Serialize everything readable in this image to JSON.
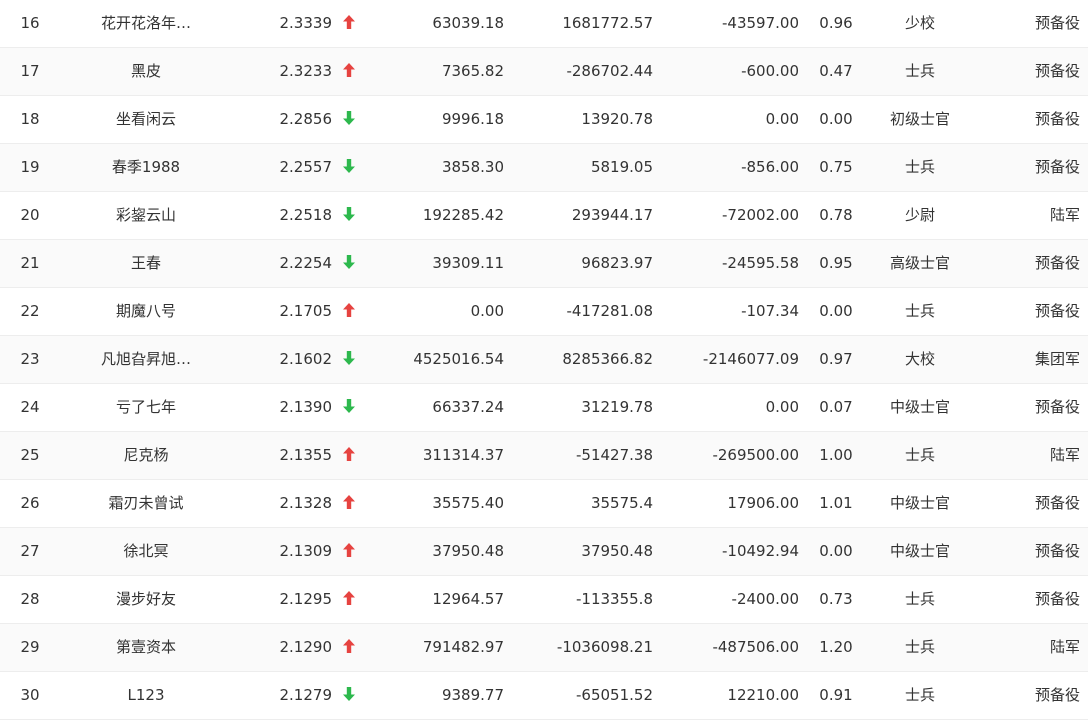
{
  "colors": {
    "up": "#e64340",
    "down": "#2db84d"
  },
  "rows": [
    {
      "rank": "16",
      "name": "花开花洛年…",
      "score": "2.3339",
      "trend": "up",
      "v1": "63039.18",
      "v2": "1681772.57",
      "v3": "-43597.00",
      "ratio": "0.96",
      "title": "少校",
      "army": "预备役"
    },
    {
      "rank": "17",
      "name": "黑皮",
      "score": "2.3233",
      "trend": "up",
      "v1": "7365.82",
      "v2": "-286702.44",
      "v3": "-600.00",
      "ratio": "0.47",
      "title": "士兵",
      "army": "预备役"
    },
    {
      "rank": "18",
      "name": "坐看闲云",
      "score": "2.2856",
      "trend": "down",
      "v1": "9996.18",
      "v2": "13920.78",
      "v3": "0.00",
      "ratio": "0.00",
      "title": "初级士官",
      "army": "预备役"
    },
    {
      "rank": "19",
      "name": "春季1988",
      "score": "2.2557",
      "trend": "down",
      "v1": "3858.30",
      "v2": "5819.05",
      "v3": "-856.00",
      "ratio": "0.75",
      "title": "士兵",
      "army": "预备役"
    },
    {
      "rank": "20",
      "name": "彩鋆云山",
      "score": "2.2518",
      "trend": "down",
      "v1": "192285.42",
      "v2": "293944.17",
      "v3": "-72002.00",
      "ratio": "0.78",
      "title": "少尉",
      "army": "陆军"
    },
    {
      "rank": "21",
      "name": "王春",
      "score": "2.2254",
      "trend": "down",
      "v1": "39309.11",
      "v2": "96823.97",
      "v3": "-24595.58",
      "ratio": "0.95",
      "title": "高级士官",
      "army": "预备役"
    },
    {
      "rank": "22",
      "name": "期魔八号",
      "score": "2.1705",
      "trend": "up",
      "v1": "0.00",
      "v2": "-417281.08",
      "v3": "-107.34",
      "ratio": "0.00",
      "title": "士兵",
      "army": "预备役"
    },
    {
      "rank": "23",
      "name": "凡旭旮昇旭…",
      "score": "2.1602",
      "trend": "down",
      "v1": "4525016.54",
      "v2": "8285366.82",
      "v3": "-2146077.09",
      "ratio": "0.97",
      "title": "大校",
      "army": "集团军"
    },
    {
      "rank": "24",
      "name": "亏了七年",
      "score": "2.1390",
      "trend": "down",
      "v1": "66337.24",
      "v2": "31219.78",
      "v3": "0.00",
      "ratio": "0.07",
      "title": "中级士官",
      "army": "预备役"
    },
    {
      "rank": "25",
      "name": "尼克杨",
      "score": "2.1355",
      "trend": "up",
      "v1": "311314.37",
      "v2": "-51427.38",
      "v3": "-269500.00",
      "ratio": "1.00",
      "title": "士兵",
      "army": "陆军"
    },
    {
      "rank": "26",
      "name": "霜刃未曾试",
      "score": "2.1328",
      "trend": "up",
      "v1": "35575.40",
      "v2": "35575.4",
      "v3": "17906.00",
      "ratio": "1.01",
      "title": "中级士官",
      "army": "预备役"
    },
    {
      "rank": "27",
      "name": "徐北冥",
      "score": "2.1309",
      "trend": "up",
      "v1": "37950.48",
      "v2": "37950.48",
      "v3": "-10492.94",
      "ratio": "0.00",
      "title": "中级士官",
      "army": "预备役"
    },
    {
      "rank": "28",
      "name": "漫步好友",
      "score": "2.1295",
      "trend": "up",
      "v1": "12964.57",
      "v2": "-113355.8",
      "v3": "-2400.00",
      "ratio": "0.73",
      "title": "士兵",
      "army": "预备役"
    },
    {
      "rank": "29",
      "name": "第壹资本",
      "score": "2.1290",
      "trend": "up",
      "v1": "791482.97",
      "v2": "-1036098.21",
      "v3": "-487506.00",
      "ratio": "1.20",
      "title": "士兵",
      "army": "陆军"
    },
    {
      "rank": "30",
      "name": "L123",
      "score": "2.1279",
      "trend": "down",
      "v1": "9389.77",
      "v2": "-65051.52",
      "v3": "12210.00",
      "ratio": "0.91",
      "title": "士兵",
      "army": "预备役"
    }
  ]
}
